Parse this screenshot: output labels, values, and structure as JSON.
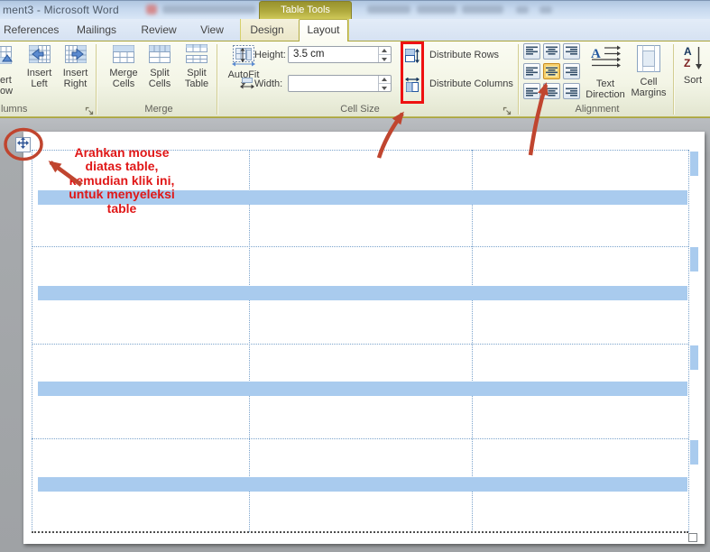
{
  "window": {
    "title": "ment3  -  Microsoft Word"
  },
  "contextual": {
    "header": "Table Tools"
  },
  "tabs": {
    "references": "References",
    "mailings": "Mailings",
    "review": "Review",
    "view": "View",
    "design": "Design",
    "layout": "Layout"
  },
  "ribbon": {
    "rows_columns": {
      "group_label": "lumns",
      "partial_button": {
        "line1": "ert",
        "line2": "ow"
      },
      "insert_left": {
        "line1": "Insert",
        "line2": "Left"
      },
      "insert_right": {
        "line1": "Insert",
        "line2": "Right"
      }
    },
    "merge": {
      "group_label": "Merge",
      "merge_cells": {
        "line1": "Merge",
        "line2": "Cells"
      },
      "split_cells": {
        "line1": "Split",
        "line2": "Cells"
      },
      "split_table": {
        "line1": "Split",
        "line2": "Table"
      }
    },
    "cell_size": {
      "group_label": "Cell Size",
      "autofit_label": "AutoFit",
      "height_label": "Height:",
      "height_value": "3.5 cm",
      "width_label": "Width:",
      "width_value": "",
      "distribute_rows_label": "Distribute Rows",
      "distribute_columns_label": "Distribute Columns"
    },
    "alignment": {
      "group_label": "Alignment",
      "text_direction": {
        "line1": "Text",
        "line2": "Direction"
      },
      "cell_margins": {
        "line1": "Cell",
        "line2": "Margins"
      }
    },
    "sort": {
      "label": "Sort"
    }
  },
  "document": {
    "annotation_lines": [
      "Arahkan mouse",
      "diatas table,",
      "kemudian klik ini,",
      "untuk menyeleksi",
      "table"
    ],
    "table": {
      "rows": 4,
      "columns": 3
    }
  },
  "colors": {
    "selection_blue": "#a9cbee",
    "annotation_red": "#e01717",
    "callout_red": "#c0452f",
    "highlight_box_red": "#ee1111",
    "contextual_olive": "#a8a23b",
    "align_button_highlight": "#fceba4"
  }
}
